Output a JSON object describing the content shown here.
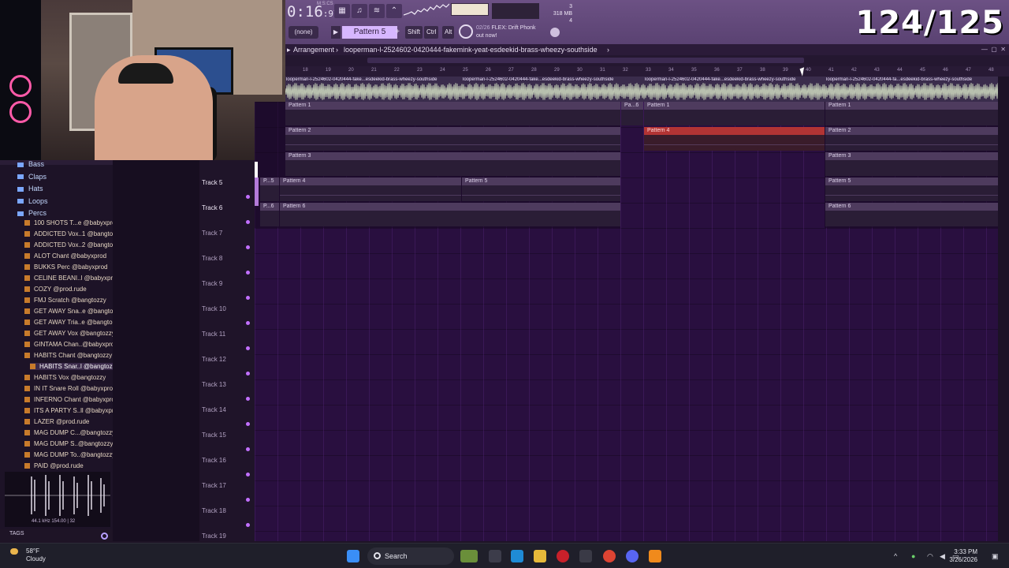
{
  "counter": "124/125",
  "toolbar": {
    "time_main": "0:16",
    "time_small": ":97",
    "time_unit": "M:S:CS",
    "memory_top": "3",
    "memory_mb": "318 MB",
    "memory_bottom": "4",
    "pattern_none": "(none)",
    "pattern_selected": "Pattern 5",
    "plus": "+",
    "shift": "Shift",
    "ctrl": "Ctrl",
    "alt": "Alt",
    "news_page": "02/26",
    "news_line1": "FLEX: Drift Phonk",
    "news_line2": "out now!"
  },
  "arrangement": {
    "title": "Arrangement",
    "separator": "›",
    "clip_path": "looperman-l-2524602-0420444-fakemink-yeat-esdeekid-brass-wheezy-southside",
    "clip_label": "looperman-l-2524602-0420444-fake...esdeekid-brass-wheezy-southside",
    "clip_label_short": "looperman-l-2524602-0420444-fa...esdeekid-brass-wheezy-southside",
    "ruler": [
      "18",
      "19",
      "20",
      "21",
      "22",
      "23",
      "24",
      "25",
      "26",
      "27",
      "28",
      "29",
      "30",
      "31",
      "32",
      "33",
      "34",
      "35",
      "36",
      "37",
      "38",
      "39",
      "40",
      "41",
      "42",
      "43",
      "44",
      "45",
      "46",
      "47",
      "48"
    ]
  },
  "patterns": {
    "p1": "Pattern 1",
    "p2": "Pattern 2",
    "p3": "Pattern 3",
    "p4": "Pattern 4",
    "p5": "Pattern 5",
    "p6": "Pattern 6",
    "p6short": "Pa...6",
    "p5short": "P...5",
    "p6short2": "P...6"
  },
  "tracks": [
    "Track 5",
    "Track 6",
    "Track 7",
    "Track 8",
    "Track 9",
    "Track 10",
    "Track 11",
    "Track 12",
    "Track 13",
    "Track 14",
    "Track 15",
    "Track 16",
    "Track 17",
    "Track 18",
    "Track 19"
  ],
  "browser": {
    "folders": [
      "Bass",
      "Claps",
      "Hats",
      "Loops",
      "Percs"
    ],
    "items": [
      "100 SHOTS T...e @babyxprod",
      "ADDICTED Vox..1 @bangtozzy",
      "ADDICTED Vox..2 @bangtozzy",
      "ALOT Chant @babyxprod",
      "BUKKS Perc @babyxprod",
      "CELINE BEANI..l @babyxprod",
      "COZY @prod.rude",
      "FMJ Scratch @bangtozzy",
      "GET AWAY Sna..e @bangtozzy",
      "GET AWAY Tria..e @bangtozzy",
      "GET AWAY Vox @bangtozzy",
      "GINTAMA Chan..@babyxprod",
      "HABITS Chant @bangtozzy",
      "HABITS Snar..l @bangtozzy",
      "HABITS Vox @bangtozzy",
      "IN IT Snare Roll @babyxprod",
      "INFERNO Chant @babyxprod",
      "ITS A PARTY S..ll @babyxprod",
      "LAZER @prod.rude",
      "MAG DUMP C...@bangtozzy",
      "MAG DUMP S..@bangtozzy",
      "MAG DUMP To..@bangtozzy",
      "PAID @prod.rude"
    ],
    "selected_index": 13,
    "preview_info": "44.1 kHz 154.00 | 32",
    "tags": "TAGS"
  },
  "taskbar": {
    "temp": "58°F",
    "condition": "Cloudy",
    "search": "Search",
    "time": "3:33 PM",
    "date": "3/26/2026"
  }
}
